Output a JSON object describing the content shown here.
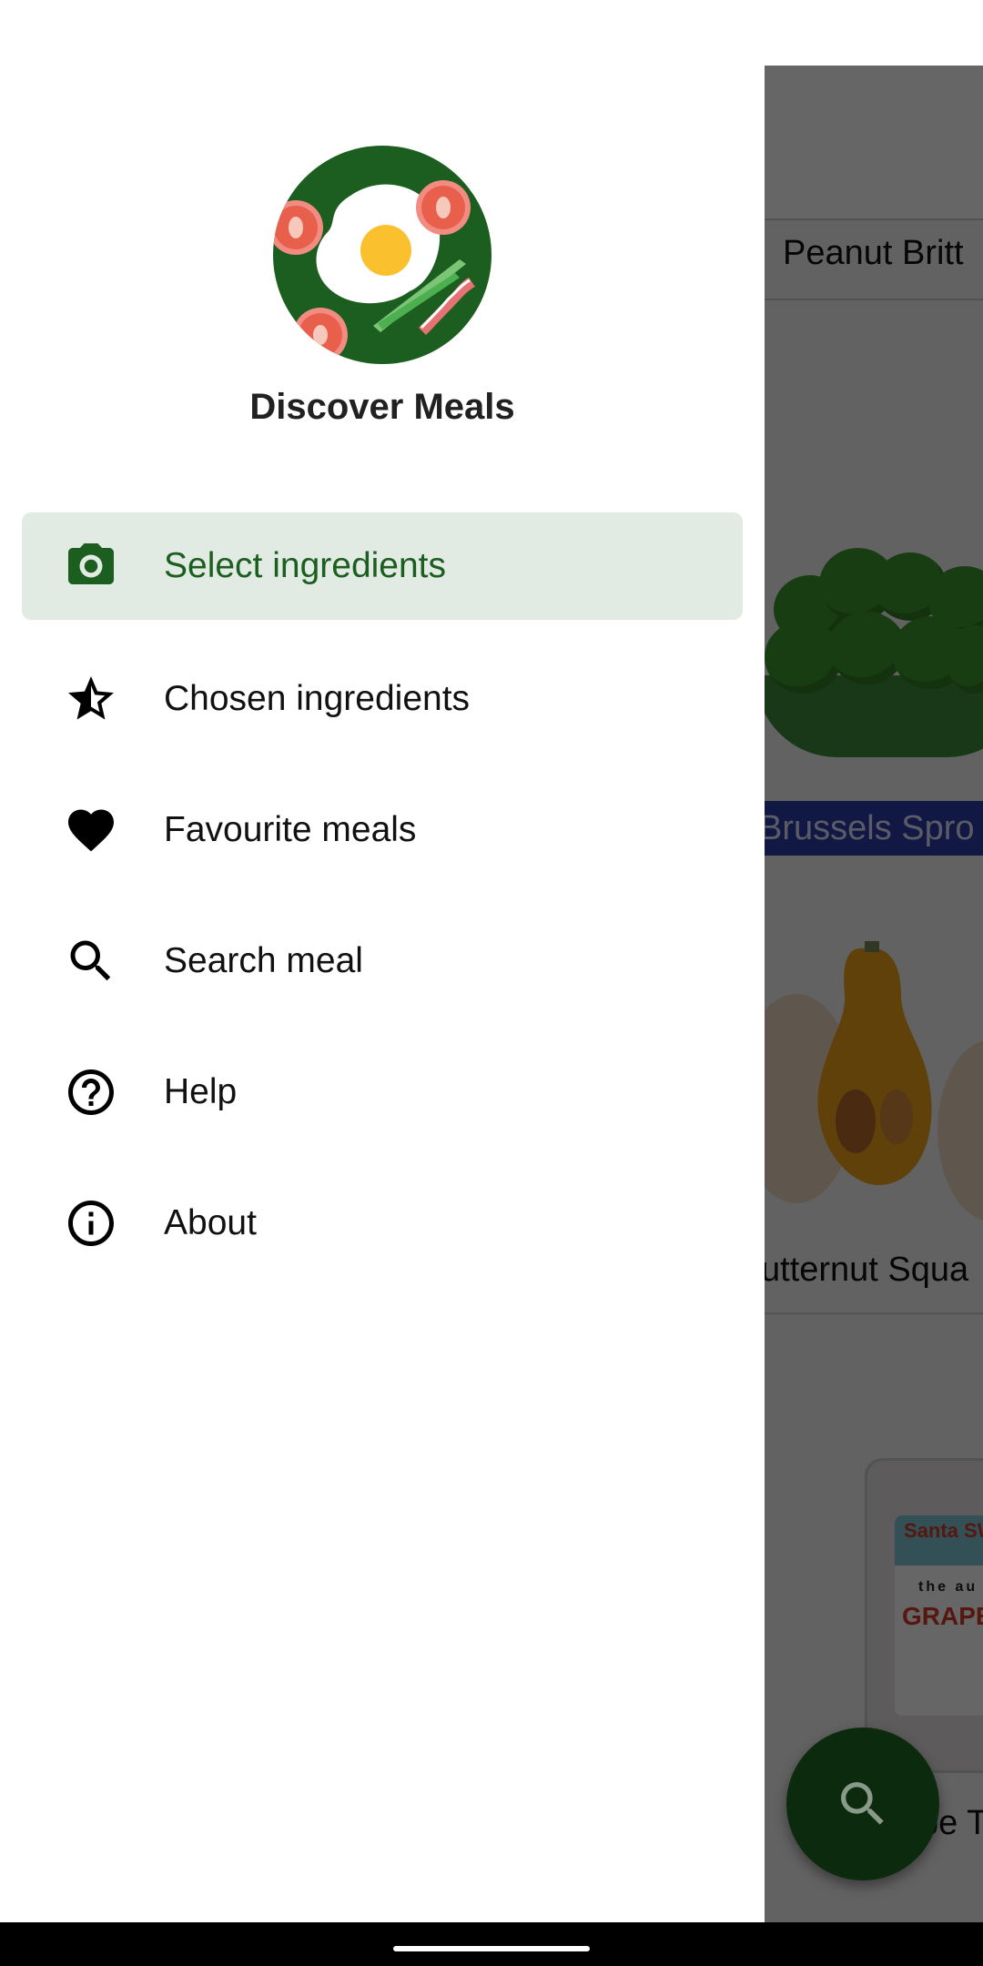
{
  "app": {
    "title": "Discover Meals",
    "accent_color": "#1b5e20",
    "active_item_bg": "#e2ebe3"
  },
  "drawer": {
    "logo_icon": "fried-egg-logo",
    "items": [
      {
        "label": "Select ingredients",
        "icon": "camera-icon",
        "active": true
      },
      {
        "label": "Chosen ingredients",
        "icon": "star-half-icon",
        "active": false
      },
      {
        "label": "Favourite meals",
        "icon": "heart-icon",
        "active": false
      },
      {
        "label": "Search meal",
        "icon": "search-icon",
        "active": false
      },
      {
        "label": "Help",
        "icon": "help-circle-icon",
        "active": false
      },
      {
        "label": "About",
        "icon": "info-icon",
        "active": false
      }
    ]
  },
  "background_list": {
    "items": [
      {
        "name": "Peanut Britt"
      },
      {
        "name": "Brussels Spro"
      },
      {
        "name": "utternut Squa"
      },
      {
        "name": "pe T"
      }
    ],
    "package_label": {
      "brand": "Santa SWEETS",
      "line1": "the au",
      "line2": "GRAPE"
    }
  },
  "fab": {
    "icon": "search-icon"
  }
}
